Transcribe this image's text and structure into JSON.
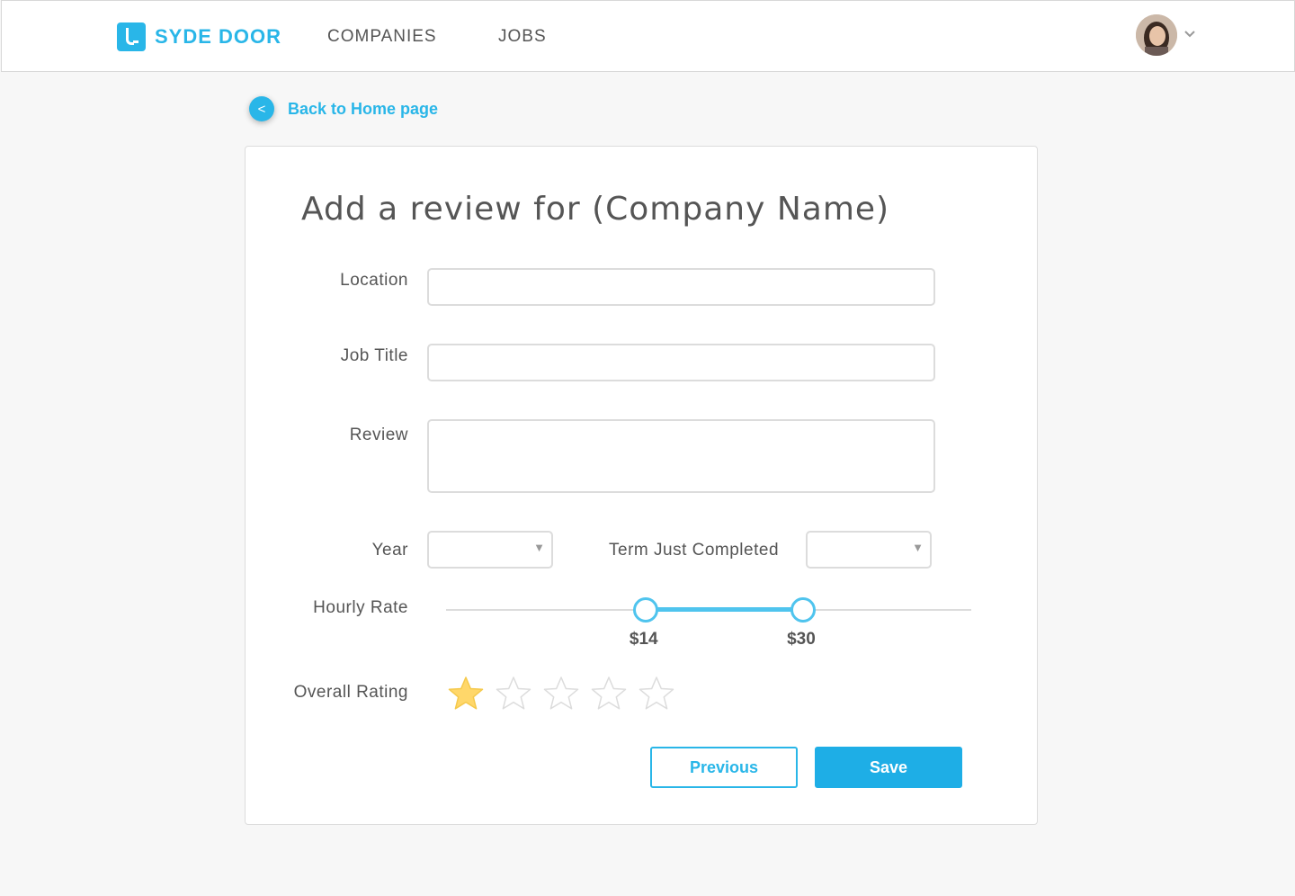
{
  "brand": {
    "name": "SYDE DOOR",
    "color": "#29b6e8"
  },
  "nav": {
    "companies": "COMPANIES",
    "jobs": "JOBS"
  },
  "user": {
    "avatar_icon": "user-avatar",
    "menu_icon": "chevron-down-icon"
  },
  "back": {
    "label": "Back to Home page",
    "icon_glyph": "<"
  },
  "form": {
    "title": "Add a review for (Company Name)",
    "location_label": "Location",
    "location_value": "",
    "job_title_label": "Job Title",
    "job_title_value": "",
    "review_label": "Review",
    "review_value": "",
    "year_label": "Year",
    "year_value": "",
    "term_label": "Term Just Completed",
    "term_value": "",
    "hourly_rate_label": "Hourly Rate",
    "hourly_rate_min": "$14",
    "hourly_rate_max": "$30",
    "hourly_rate_min_fraction": 0.38,
    "hourly_rate_max_fraction": 0.68,
    "overall_rating_label": "Overall Rating",
    "rating": 1,
    "rating_max": 5,
    "previous_label": "Previous",
    "save_label": "Save"
  },
  "colors": {
    "accent": "#29b6e8",
    "star_filled": "#ffd76a",
    "star_empty": "#dcdcdc"
  }
}
